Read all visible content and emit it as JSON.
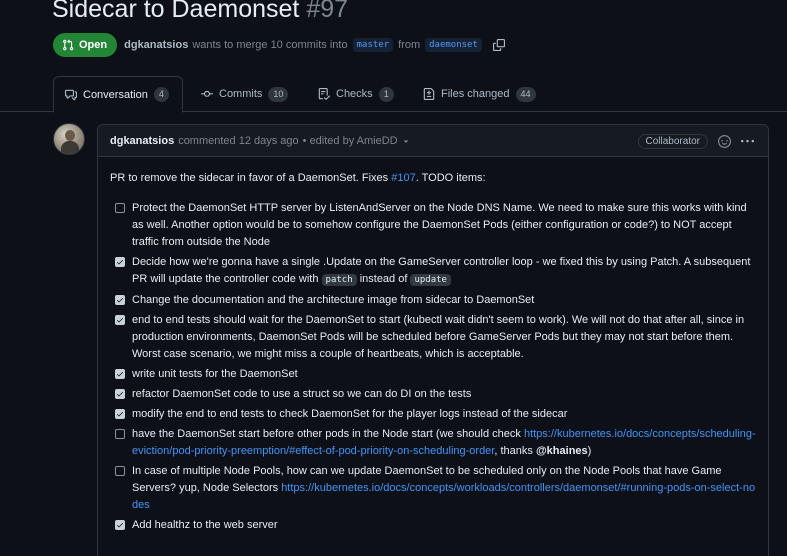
{
  "pr": {
    "title": "Sidecar to Daemonset",
    "number": "#97",
    "state": "Open",
    "author": "dgkanatsios",
    "merge_text_1": "wants to merge 10 commits into",
    "base_branch": "master",
    "from_word": "from",
    "head_branch": "daemonset"
  },
  "tabs": [
    {
      "label": "Conversation",
      "count": "4"
    },
    {
      "label": "Commits",
      "count": "10"
    },
    {
      "label": "Checks",
      "count": "1"
    },
    {
      "label": "Files changed",
      "count": "44"
    }
  ],
  "comment": {
    "author": "dgkanatsios",
    "action": "commented 12 days ago",
    "edited": "• edited by AmieDD",
    "role": "Collaborator",
    "intro_pre": "PR to remove the sidecar in favor of a DaemonSet. Fixes ",
    "intro_link": "#107",
    "intro_post": ". TODO items:",
    "tasks": [
      {
        "checked": false,
        "text": "Protect the DaemonSet HTTP server by ListenAndServer on the Node DNS Name. We need to make sure this works with kind as well. Another option would be to somehow configure the DaemonSet Pods (either configuration or code?) to NOT accept traffic from outside the Node"
      },
      {
        "checked": true,
        "text_a": "Decide how we're gonna have a single .Update on the GameServer controller loop - we fixed this by using Patch. A subsequent PR will update the controller code with ",
        "code_a": "patch",
        "text_b": " instead of ",
        "code_b": "update"
      },
      {
        "checked": true,
        "text": "Change the documentation and the architecture image from sidecar to DaemonSet"
      },
      {
        "checked": true,
        "text": "end to end tests should wait for the DaemonSet to start (kubectl wait didn't seem to work). We will not do that after all, since in production environments, DaemonSet Pods will be scheduled before GameServer Pods but they may not start before them. Worst case scenario, we might miss a couple of heartbeats, which is acceptable."
      },
      {
        "checked": true,
        "text": "write unit tests for the DaemonSet"
      },
      {
        "checked": true,
        "text": "refactor DaemonSet code to use a struct so we can do DI on the tests"
      },
      {
        "checked": true,
        "text": "modify the end to end tests to check DaemonSet for the player logs instead of the sidecar"
      },
      {
        "checked": false,
        "text_a": "have the DaemonSet start before other pods in the Node start (we should check ",
        "link": "https://kubernetes.io/docs/concepts/scheduling-eviction/pod-priority-preemption/#effect-of-pod-priority-on-scheduling-order",
        "text_b": ", thanks ",
        "mention": "@khaines",
        "text_c": ")"
      },
      {
        "checked": false,
        "text_a": "In case of multiple Node Pools, how can we update DaemonSet to be scheduled only on the Node Pools that have Game Servers? yup, Node Selectors ",
        "link": "https://kubernetes.io/docs/concepts/workloads/controllers/daemonset/#running-pods-on-select-nodes"
      },
      {
        "checked": true,
        "text": "Add healthz to the web server"
      }
    ]
  },
  "colors": {
    "background": "#0d1117",
    "open_green": "#238636",
    "link": "#4493f8",
    "border": "#30363d"
  }
}
